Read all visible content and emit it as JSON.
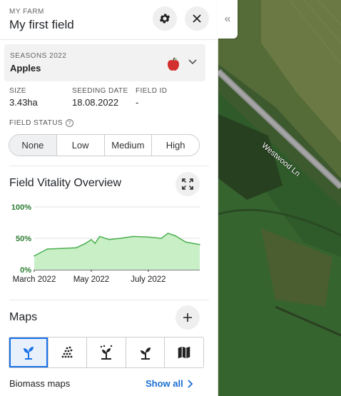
{
  "header": {
    "farm_label": "MY FARM",
    "field_title": "My first field"
  },
  "season": {
    "label": "SEASONS 2022",
    "crop": "Apples"
  },
  "info": [
    {
      "key": "SIZE",
      "value": "3.43ha"
    },
    {
      "key": "SEEDING DATE",
      "value": "18.08.2022"
    },
    {
      "key": "FIELD ID",
      "value": "-"
    }
  ],
  "field_status": {
    "label": "FIELD STATUS",
    "options": [
      "None",
      "Low",
      "Medium",
      "High"
    ],
    "selected": "None"
  },
  "vitality": {
    "title": "Field Vitality Overview"
  },
  "chart_data": {
    "type": "area",
    "title": "Field Vitality Overview",
    "xlabel": "",
    "ylabel": "",
    "ylim": [
      0,
      100
    ],
    "yticks": [
      "0%",
      "50%",
      "100%"
    ],
    "xticks": [
      "March 2022",
      "May 2022",
      "July 2022"
    ],
    "x": [
      "2022-03-01",
      "2022-03-15",
      "2022-04-01",
      "2022-04-15",
      "2022-04-25",
      "2022-05-01",
      "2022-05-05",
      "2022-05-10",
      "2022-05-20",
      "2022-06-01",
      "2022-06-15",
      "2022-07-01",
      "2022-07-15",
      "2022-07-22",
      "2022-07-30",
      "2022-08-10",
      "2022-08-25"
    ],
    "values": [
      22,
      33,
      34,
      35,
      42,
      48,
      42,
      53,
      48,
      50,
      53,
      52,
      50,
      58,
      54,
      44,
      40
    ],
    "color": "#4caf50"
  },
  "maps": {
    "title": "Maps",
    "tabs": [
      {
        "icon": "plant-icon",
        "active": true
      },
      {
        "icon": "seeding-dots-icon",
        "active": false
      },
      {
        "icon": "fertilizer-plant-icon",
        "active": false
      },
      {
        "icon": "sprout-icon",
        "active": false
      },
      {
        "icon": "map-icon",
        "active": false
      }
    ],
    "biomass_label": "Biomass maps",
    "show_all": "Show all"
  },
  "map_view": {
    "road_label": "Westwood Ln"
  }
}
